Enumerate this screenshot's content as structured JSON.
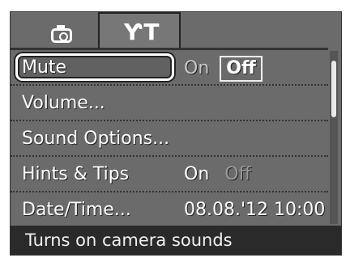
{
  "tabs": [
    {
      "icon": "camera-icon"
    },
    {
      "label": "ƳT",
      "icon": "setup-tools-icon"
    }
  ],
  "menu": {
    "items": [
      {
        "label": "Mute",
        "options": [
          "On",
          "Off"
        ],
        "selected_option": "Off"
      },
      {
        "label": "Volume..."
      },
      {
        "label": "Sound Options..."
      },
      {
        "label": "Hints & Tips",
        "options": [
          "On",
          "Off"
        ],
        "selected_option": "On"
      },
      {
        "label": "Date/Time...",
        "value": "08.08.'12 10:00"
      }
    ]
  },
  "footer": {
    "hint": "Turns on camera sounds"
  }
}
